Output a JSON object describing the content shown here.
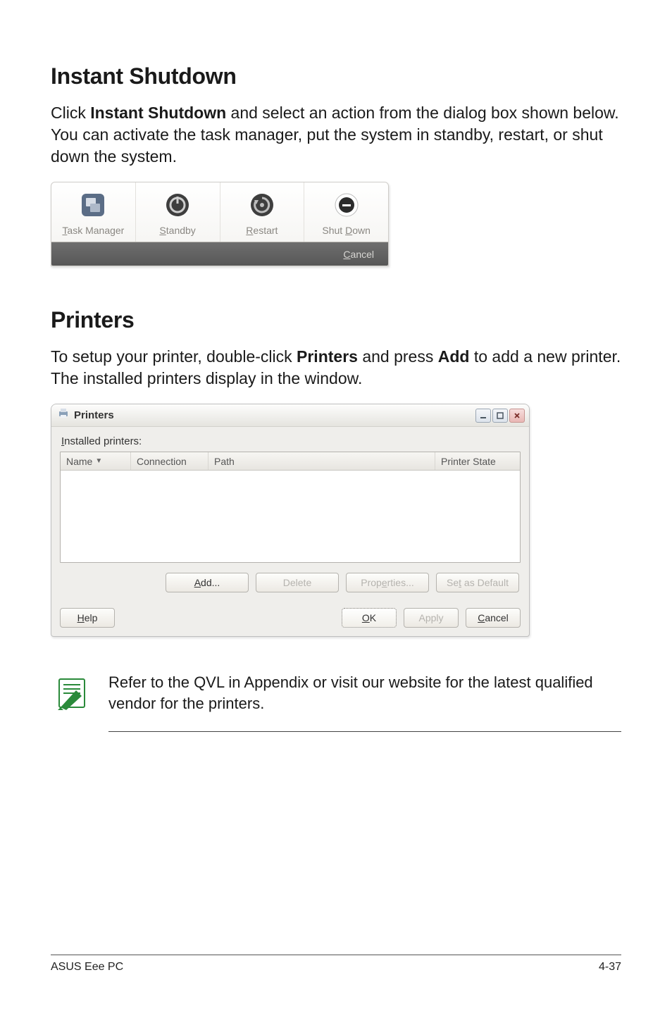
{
  "sections": {
    "instant_shutdown": {
      "heading": "Instant Shutdown",
      "para_pre": "Click ",
      "para_bold": "Instant Shutdown",
      "para_post": " and select an action from the dialog box shown below. You can activate the task manager, put the system in standby, restart, or shut down the system."
    },
    "printers": {
      "heading": "Printers",
      "para_pre": "To setup your printer, double-click ",
      "para_bold1": "Printers",
      "para_mid": " and press ",
      "para_bold2": "Add",
      "para_post": " to add a new printer. The installed printers display in the window."
    }
  },
  "shutdown_dialog": {
    "cells": [
      {
        "label_pre": "",
        "ul": "T",
        "label_post": "ask Manager"
      },
      {
        "label_pre": "",
        "ul": "S",
        "label_post": "tandby"
      },
      {
        "label_pre": "",
        "ul": "R",
        "label_post": "estart"
      },
      {
        "label_pre": "Shut ",
        "ul": "D",
        "label_post": "own"
      }
    ],
    "cancel_pre": "",
    "cancel_ul": "C",
    "cancel_post": "ancel"
  },
  "printers_dialog": {
    "title": "Printers",
    "installed_pre": "",
    "installed_ul": "I",
    "installed_post": "nstalled printers:",
    "columns": {
      "name": "Name",
      "connection": "Connection",
      "path": "Path",
      "state": "Printer State"
    },
    "buttons": {
      "add_ul": "A",
      "add_post": "dd...",
      "delete": "Delete",
      "props_pre": "Prop",
      "props_ul": "e",
      "props_post": "rties...",
      "default_pre": "Se",
      "default_ul": "t",
      "default_post": " as Default",
      "help_ul": "H",
      "help_post": "elp",
      "ok_ul": "O",
      "ok_post": "K",
      "apply": "Apply",
      "cancel_ul": "C",
      "cancel_post": "ancel"
    }
  },
  "note": {
    "text": "Refer to the QVL in Appendix or visit our website for the latest qualified vendor for the printers."
  },
  "footer": {
    "left": "ASUS Eee PC",
    "right": "4-37"
  }
}
